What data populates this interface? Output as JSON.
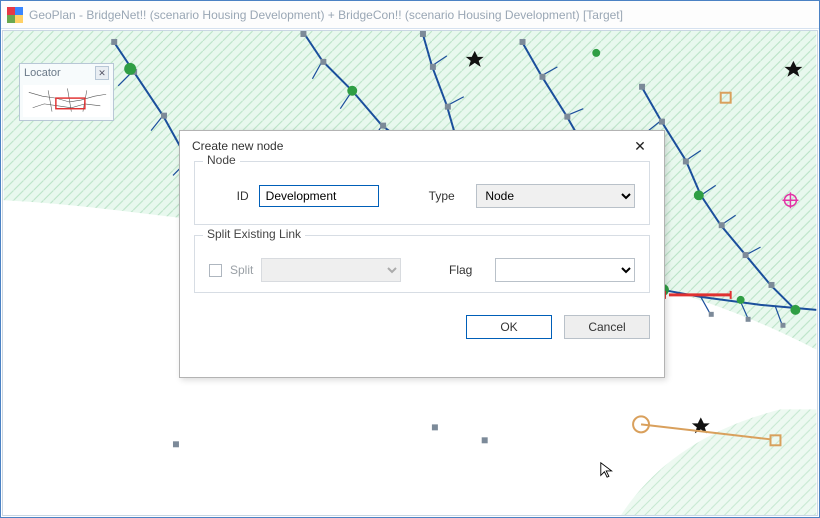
{
  "window": {
    "title": "GeoPlan - BridgeNet!! (scenario Housing Development)  + BridgeCon!! (scenario Housing Development)  [Target]"
  },
  "locator": {
    "title": "Locator",
    "close_glyph": "✕"
  },
  "dialog": {
    "title": "Create new node",
    "close_glyph": "✕",
    "group_node": {
      "legend": "Node",
      "id_label": "ID",
      "id_value": "Development",
      "type_label": "Type",
      "type_value": "Node"
    },
    "group_split": {
      "legend": "Split Existing Link",
      "split_label": "Split",
      "split_checked": false,
      "flag_label": "Flag",
      "flag_value": ""
    },
    "ok_label": "OK",
    "cancel_label": "Cancel"
  }
}
